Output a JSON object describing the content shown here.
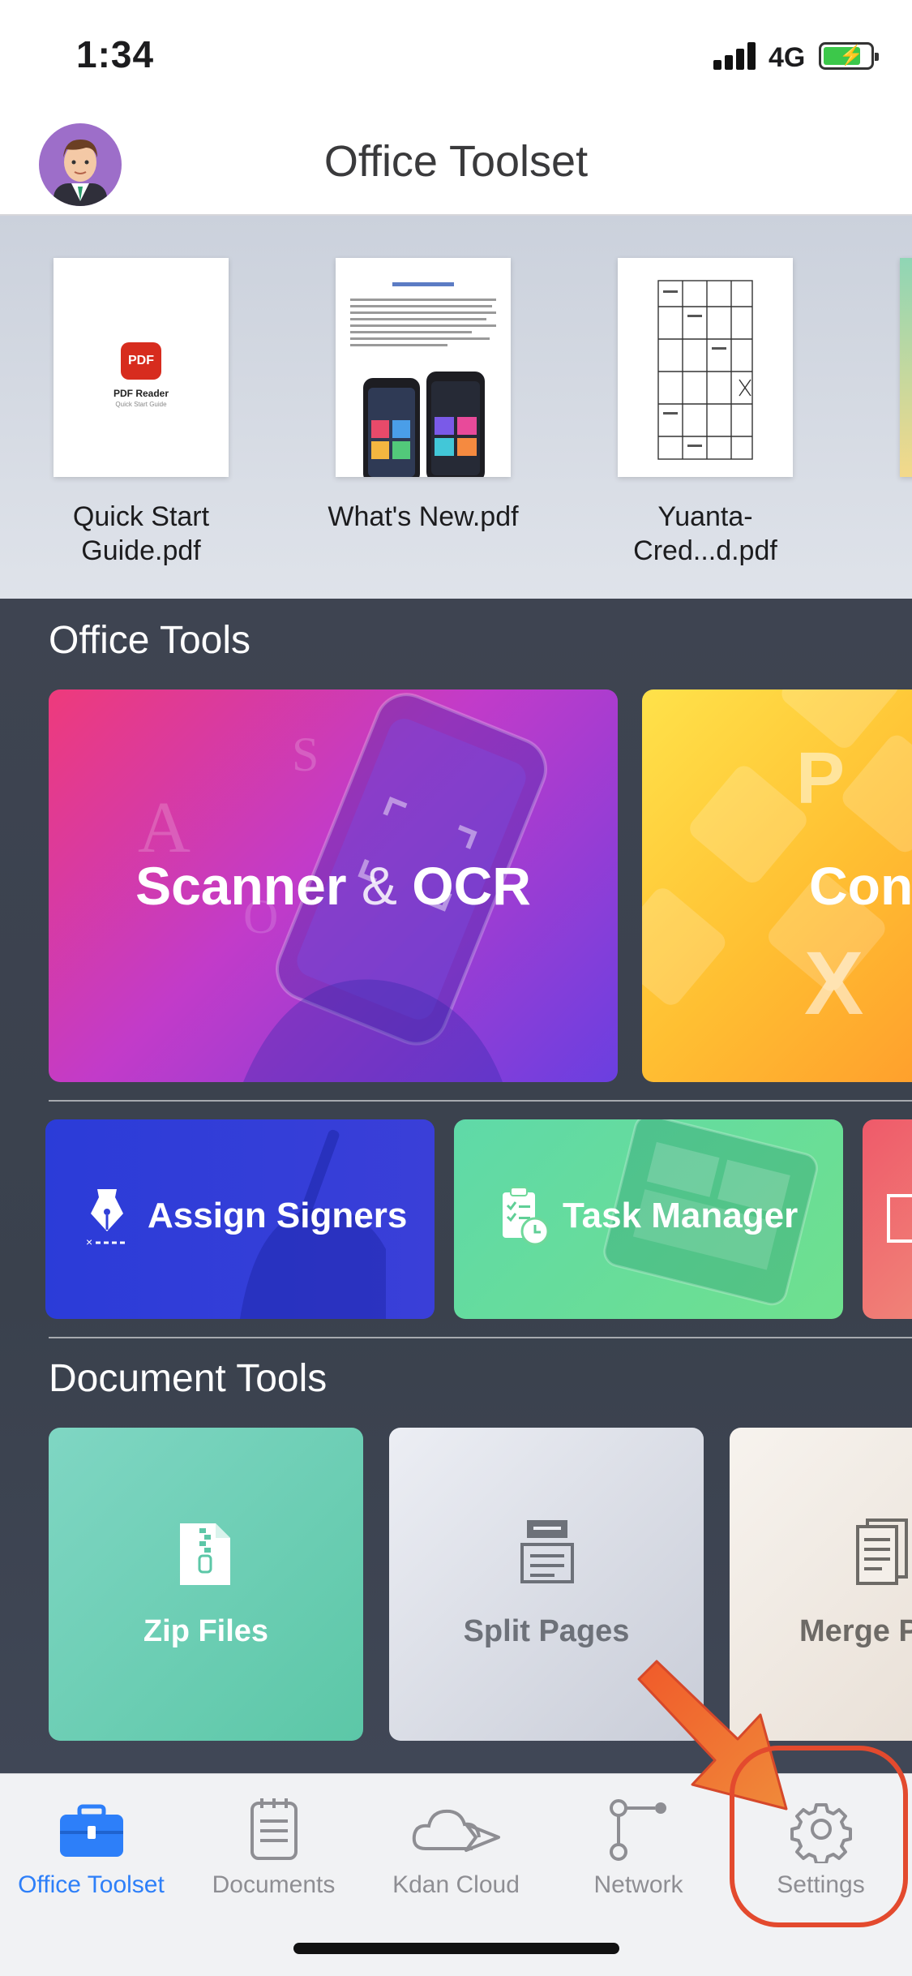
{
  "status_bar": {
    "time": "1:34",
    "network": "4G"
  },
  "header": {
    "title": "Office Toolset"
  },
  "recent_files": [
    {
      "name": "Quick Start Guide.pdf",
      "thumb_title": "PDF Reader",
      "thumb_subtitle": "Quick Start Guide",
      "thumb_badge": "PDF"
    },
    {
      "name": "What's New.pdf"
    },
    {
      "name": "Yuanta-Cred...d.pdf"
    }
  ],
  "office_tools": {
    "title": "Office Tools",
    "scanner_amp": "&",
    "cards": [
      {
        "label": "Scanner & OCR",
        "label_left": "Scanner",
        "label_right": "OCR"
      },
      {
        "label": "Con"
      }
    ],
    "small_cards": [
      {
        "label": "Assign Signers"
      },
      {
        "label": "Task Manager"
      }
    ]
  },
  "document_tools": {
    "title": "Document Tools",
    "cards": [
      {
        "label": "Zip Files"
      },
      {
        "label": "Split Pages"
      },
      {
        "label": "Merge P"
      }
    ]
  },
  "tab_bar": {
    "tabs": [
      {
        "label": "Office Toolset",
        "icon": "briefcase-icon",
        "active": true
      },
      {
        "label": "Documents",
        "icon": "documents-icon",
        "active": false
      },
      {
        "label": "Kdan Cloud",
        "icon": "cloud-icon",
        "active": false
      },
      {
        "label": "Network",
        "icon": "network-icon",
        "active": false
      },
      {
        "label": "Settings",
        "icon": "gear-icon",
        "active": false
      }
    ]
  },
  "colors": {
    "accent": "#2d7ff9",
    "annotation": "#e34a2e"
  }
}
